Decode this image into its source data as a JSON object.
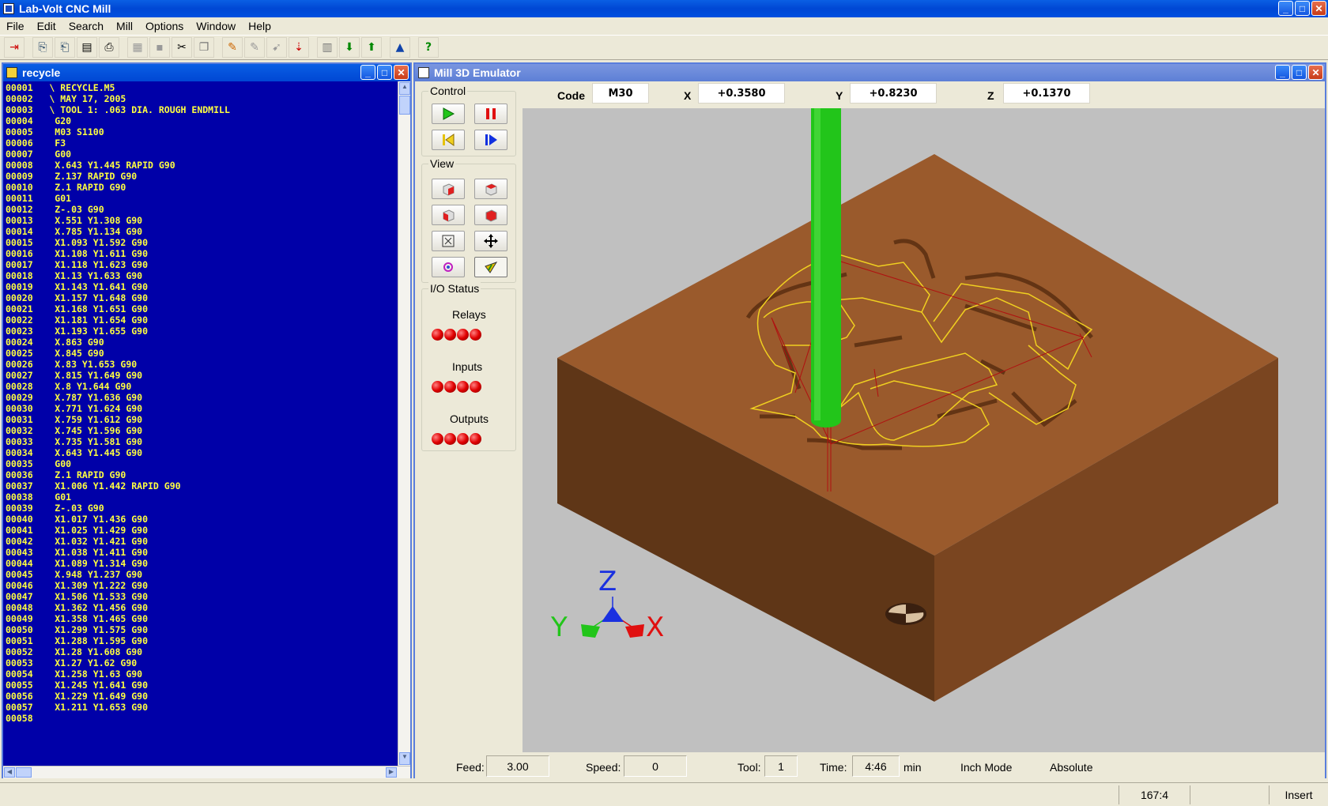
{
  "app": {
    "title": "Lab-Volt CNC Mill"
  },
  "menu": [
    "File",
    "Edit",
    "Search",
    "Mill",
    "Options",
    "Window",
    "Help"
  ],
  "editor": {
    "title": "recycle",
    "lines": [
      "00001   \\ RECYCLE.M5",
      "00002   \\ MAY 17, 2005",
      "00003   \\ TOOL 1: .063 DIA. ROUGH ENDMILL",
      "00004    G20",
      "00005    M03 S1100",
      "00006    F3",
      "00007    G00",
      "00008    X.643 Y1.445 RAPID G90",
      "00009    Z.137 RAPID G90",
      "00010    Z.1 RAPID G90",
      "00011    G01",
      "00012    Z-.03 G90",
      "00013    X.551 Y1.308 G90",
      "00014    X.785 Y1.134 G90",
      "00015    X1.093 Y1.592 G90",
      "00016    X1.108 Y1.611 G90",
      "00017    X1.118 Y1.623 G90",
      "00018    X1.13 Y1.633 G90",
      "00019    X1.143 Y1.641 G90",
      "00020    X1.157 Y1.648 G90",
      "00021    X1.168 Y1.651 G90",
      "00022    X1.181 Y1.654 G90",
      "00023    X1.193 Y1.655 G90",
      "00024    X.863 G90",
      "00025    X.845 G90",
      "00026    X.83 Y1.653 G90",
      "00027    X.815 Y1.649 G90",
      "00028    X.8 Y1.644 G90",
      "00029    X.787 Y1.636 G90",
      "00030    X.771 Y1.624 G90",
      "00031    X.759 Y1.612 G90",
      "00032    X.745 Y1.596 G90",
      "00033    X.735 Y1.581 G90",
      "00034    X.643 Y1.445 G90",
      "00035    G00",
      "00036    Z.1 RAPID G90",
      "00037    X1.006 Y1.442 RAPID G90",
      "00038    G01",
      "00039    Z-.03 G90",
      "00040    X1.017 Y1.436 G90",
      "00041    X1.025 Y1.429 G90",
      "00042    X1.032 Y1.421 G90",
      "00043    X1.038 Y1.411 G90",
      "00044    X1.089 Y1.314 G90",
      "00045    X.948 Y1.237 G90",
      "00046    X1.309 Y1.222 G90",
      "00047    X1.506 Y1.533 G90",
      "00048    X1.362 Y1.456 G90",
      "00049    X1.358 Y1.465 G90",
      "00050    X1.299 Y1.575 G90",
      "00051    X1.288 Y1.595 G90",
      "00052    X1.28 Y1.608 G90",
      "00053    X1.27 Y1.62 G90",
      "00054    X1.258 Y1.63 G90",
      "00055    X1.245 Y1.641 G90",
      "00056    X1.229 Y1.649 G90",
      "00057    X1.211 Y1.653 G90",
      "00058"
    ]
  },
  "emulator": {
    "title": "Mill 3D Emulator",
    "groups": {
      "control": "Control",
      "view": "View",
      "io": "I/O Status"
    },
    "io": {
      "relays": "Relays",
      "inputs": "Inputs",
      "outputs": "Outputs"
    },
    "readouts": {
      "code_label": "Code",
      "code": "M30",
      "x_label": "X",
      "x": "+0.3580",
      "y_label": "Y",
      "y": "+0.8230",
      "z_label": "Z",
      "z": "+0.1370"
    },
    "bottom": {
      "feed_label": "Feed:",
      "feed": "3.00",
      "speed_label": "Speed:",
      "speed": "0",
      "tool_label": "Tool:",
      "tool": "1",
      "time_label": "Time:",
      "time": "4:46",
      "time_unit": "min",
      "mode": "Inch Mode",
      "positioning": "Absolute"
    },
    "axis_labels": {
      "x": "X",
      "y": "Y",
      "z": "Z"
    },
    "colors": {
      "stock_top": "#9a5a2c",
      "stock_front": "#5f3617",
      "stock_right": "#7a4520",
      "tool": "#22c51a",
      "toolpath": "#f0d020",
      "rapid": "#b01010",
      "background": "#c0c0c0"
    }
  },
  "toolbar_icons": [
    "exit-icon",
    "open-icon",
    "save-icon",
    "new-icon",
    "print-icon",
    "disabled-icon",
    "disabled-icon",
    "cut-icon",
    "copy-icon",
    "find-icon",
    "find-disabled-icon",
    "find-next-icon",
    "jump-icon",
    "grid-icon",
    "download-icon",
    "upload-icon",
    "emulator-icon",
    "help-icon"
  ],
  "statusbar": {
    "position": "167:4",
    "mode": "Insert"
  }
}
